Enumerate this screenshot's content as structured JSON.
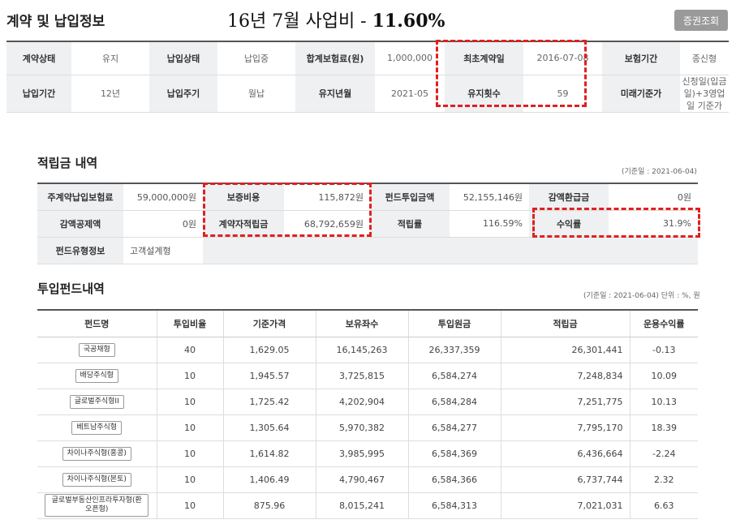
{
  "header": {
    "title": "계약 및 납입정보",
    "overlay_text": "16년 7월 사업비 - ",
    "overlay_pct": "11.60%",
    "cert_button": "증권조회"
  },
  "contract": {
    "row1": [
      {
        "label": "계약상태",
        "value": "유지"
      },
      {
        "label": "납입상태",
        "value": "납입중"
      },
      {
        "label": "합계보험료(원)",
        "value": "1,000,000"
      },
      {
        "label": "최초계약일",
        "value": "2016-07-08"
      },
      {
        "label": "보험기간",
        "value": "종신형"
      }
    ],
    "row2": [
      {
        "label": "납입기간",
        "value": "12년"
      },
      {
        "label": "납입주기",
        "value": "월납"
      },
      {
        "label": "유지년월",
        "value": "2021-05"
      },
      {
        "label": "유지횟수",
        "value": "59"
      },
      {
        "label": "미래기준가",
        "value": "신청일(입금일)+3영업일 기준가"
      }
    ]
  },
  "reserve": {
    "title": "적립금 내역",
    "note": "(기준일 : 2021-06-04)",
    "row1": [
      {
        "label": "주계약납입보험료",
        "value": "59,000,000원"
      },
      {
        "label": "보증비용",
        "value": "115,872원"
      },
      {
        "label": "펀드투입금액",
        "value": "52,155,146원"
      },
      {
        "label": "감액환급금",
        "value": "0원"
      }
    ],
    "row2": [
      {
        "label": "감액공제액",
        "value": "0원"
      },
      {
        "label": "계약자적립금",
        "value": "68,792,659원"
      },
      {
        "label": "적립률",
        "value": "116.59%"
      },
      {
        "label": "수익률",
        "value": "31.9%"
      }
    ],
    "row3": {
      "label": "펀드유형정보",
      "value": "고객설계형"
    }
  },
  "funds": {
    "title": "투입펀드내역",
    "note": "(기준일 : 2021-06-04) 단위 : %, 원",
    "headers": [
      "펀드명",
      "투입비율",
      "기준가격",
      "보유좌수",
      "투입원금",
      "적립금",
      "운용수익률"
    ],
    "rows": [
      {
        "name": "국공채형",
        "ratio": "40",
        "price": "1,629.05",
        "units": "16,145,263",
        "principal": "26,337,359",
        "reserve": "26,301,441",
        "yield": "-0.13"
      },
      {
        "name": "배당주식형",
        "ratio": "10",
        "price": "1,945.57",
        "units": "3,725,815",
        "principal": "6,584,274",
        "reserve": "7,248,834",
        "yield": "10.09"
      },
      {
        "name": "글로벌주식형II",
        "ratio": "10",
        "price": "1,725.42",
        "units": "4,202,904",
        "principal": "6,584,284",
        "reserve": "7,251,775",
        "yield": "10.13"
      },
      {
        "name": "베트남주식형",
        "ratio": "10",
        "price": "1,305.64",
        "units": "5,970,382",
        "principal": "6,584,277",
        "reserve": "7,795,170",
        "yield": "18.39"
      },
      {
        "name": "차이나주식형(홍콩)",
        "ratio": "10",
        "price": "1,614.82",
        "units": "3,985,995",
        "principal": "6,584,369",
        "reserve": "6,436,664",
        "yield": "-2.24"
      },
      {
        "name": "차이나주식형(본토)",
        "ratio": "10",
        "price": "1,406.49",
        "units": "4,790,467",
        "principal": "6,584,366",
        "reserve": "6,737,744",
        "yield": "2.32"
      },
      {
        "name": "글로벌부동산인프라투자형(환오픈형)",
        "ratio": "10",
        "price": "875.96",
        "units": "8,015,241",
        "principal": "6,584,313",
        "reserve": "7,021,031",
        "yield": "6.63"
      }
    ]
  },
  "colors": {
    "highlight": "#e02020",
    "label_bg": "#eef0f2",
    "button_bg": "#9a9a9a"
  }
}
